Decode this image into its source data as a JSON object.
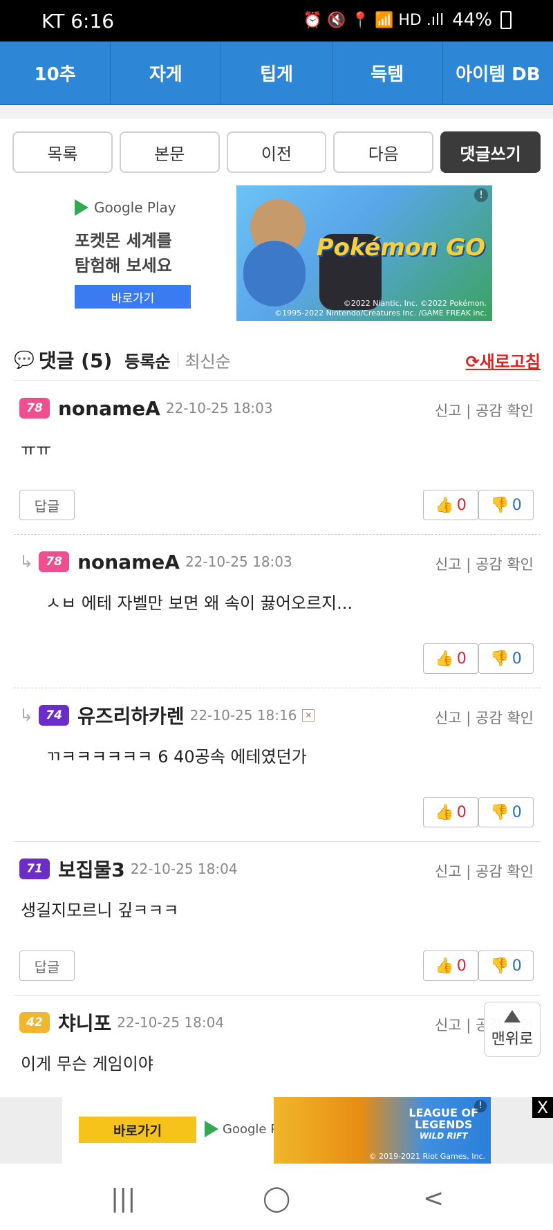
{
  "status": {
    "carrier_time": "KT 6:16",
    "icons": "⏰ 🔇 📍 📶 HD .ıll",
    "battery": "44%"
  },
  "nav": {
    "tabs": [
      "10추",
      "자게",
      "팁게",
      "득템",
      "아이템 DB"
    ]
  },
  "actions": {
    "list": "목록",
    "body": "본문",
    "prev": "이전",
    "next": "다음",
    "write": "댓글쓰기"
  },
  "ad_top": {
    "store": "Google Play",
    "line1": "포켓몬 세계를",
    "line2": "탐험해 보세요",
    "button": "바로가기",
    "logo": "Pokémon GO",
    "copy1": "©2022 Niantic, Inc. ©2022 Pokémon.",
    "copy2": "©1995-2022 Nintendo/Creatures Inc. /GAME FREAK inc.",
    "mark": "!"
  },
  "comments_header": {
    "title": "댓글 (5)",
    "sort_reg": "등록순",
    "sort_new": "최신순",
    "refresh": "새로고침"
  },
  "labels": {
    "report": "신고 | 공감 확인",
    "reply": "답글"
  },
  "comments": [
    {
      "lv": "78",
      "user": "nonameA",
      "date": "22-10-25 18:03",
      "text": "ㅠㅠ",
      "up": "0",
      "down": "0"
    },
    {
      "lv": "78",
      "user": "nonameA",
      "date": "22-10-25 18:03",
      "text": "ㅅㅂ 에테 자벨만 보면 왜 속이 끓어오르지...",
      "up": "0",
      "down": "0"
    },
    {
      "lv": "74",
      "user": "유즈리하카렌",
      "date": "22-10-25 18:16",
      "text": "ㄲㅋㅋㅋㅋㅋㅋ 6 40공속 에테였던가",
      "up": "0",
      "down": "0"
    },
    {
      "lv": "71",
      "user": "보집물3",
      "date": "22-10-25 18:04",
      "text": "생길지모르니 깊ㅋㅋㅋ",
      "up": "0",
      "down": "0"
    },
    {
      "lv": "42",
      "user": "챠니포",
      "date": "22-10-25 18:04",
      "text": "이게 무슨 게임이야"
    }
  ],
  "totop": "맨위로",
  "ad_bottom": {
    "button": "바로가기",
    "store": "Google Play",
    "logo_l1": "LEAGUE OF",
    "logo_l2": "LEGENDS",
    "logo_l3": "WILD RIFT",
    "copy": "© 2019-2021 Riot Games, Inc.",
    "mark": "!",
    "close": "X"
  },
  "navbar": {
    "recent": "|||",
    "home": "◯",
    "back": "<"
  }
}
